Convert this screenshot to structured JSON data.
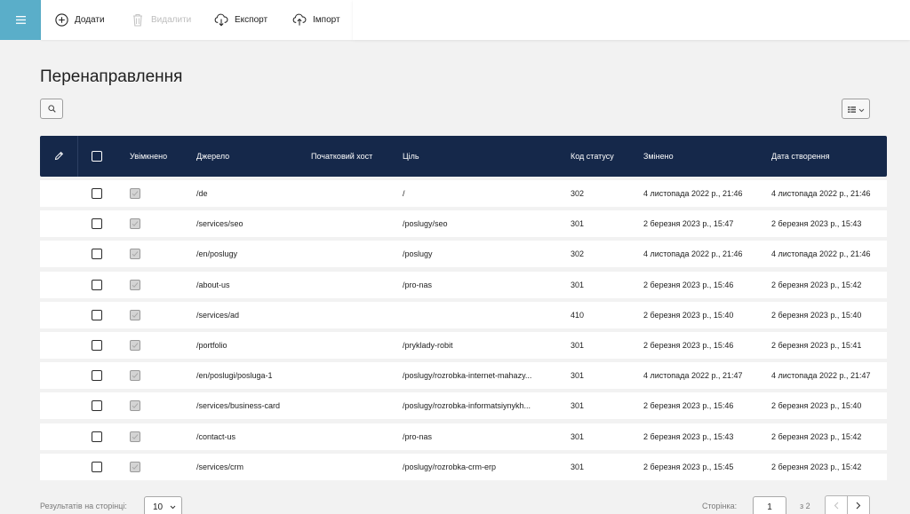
{
  "toolbar": {
    "add_label": "Додати",
    "delete_label": "Видалити",
    "export_label": "Експорт",
    "import_label": "Імпорт"
  },
  "page": {
    "title": "Перенаправлення"
  },
  "colors": {
    "accent": "#5aaec9",
    "header_bg": "#15284a",
    "page_bg": "#f2f2f2"
  },
  "table": {
    "headers": {
      "enabled": "Увімкнено",
      "source": "Джерело",
      "origin_host": "Початковий хост",
      "target": "Ціль",
      "status_code": "Код статусу",
      "modified": "Змінено",
      "created": "Дата створення"
    },
    "rows": [
      {
        "source": "/de",
        "host": "",
        "target": "/",
        "code": "302",
        "modified": "4 листопада 2022 р., 21:46",
        "created": "4 листопада 2022 р., 21:46"
      },
      {
        "source": "/services/seo",
        "host": "",
        "target": "/poslugy/seo",
        "code": "301",
        "modified": "2 березня 2023 р., 15:47",
        "created": "2 березня 2023 р., 15:43"
      },
      {
        "source": "/en/poslugy",
        "host": "",
        "target": "/poslugy",
        "code": "302",
        "modified": "4 листопада 2022 р., 21:46",
        "created": "4 листопада 2022 р., 21:46"
      },
      {
        "source": "/about-us",
        "host": "",
        "target": "/pro-nas",
        "code": "301",
        "modified": "2 березня 2023 р., 15:46",
        "created": "2 березня 2023 р., 15:42"
      },
      {
        "source": "/services/ad",
        "host": "",
        "target": "",
        "code": "410",
        "modified": "2 березня 2023 р., 15:40",
        "created": "2 березня 2023 р., 15:40"
      },
      {
        "source": "/portfolio",
        "host": "",
        "target": "/pryklady-robit",
        "code": "301",
        "modified": "2 березня 2023 р., 15:46",
        "created": "2 березня 2023 р., 15:41"
      },
      {
        "source": "/en/poslugi/posluga-1",
        "host": "",
        "target": "/poslugy/rozrobka-internet-mahazy...",
        "code": "301",
        "modified": "4 листопада 2022 р., 21:47",
        "created": "4 листопада 2022 р., 21:47"
      },
      {
        "source": "/services/business-card",
        "host": "",
        "target": "/poslugy/rozrobka-informatsiynykh...",
        "code": "301",
        "modified": "2 березня 2023 р., 15:46",
        "created": "2 березня 2023 р., 15:40"
      },
      {
        "source": "/contact-us",
        "host": "",
        "target": "/pro-nas",
        "code": "301",
        "modified": "2 березня 2023 р., 15:43",
        "created": "2 березня 2023 р., 15:42"
      },
      {
        "source": "/services/crm",
        "host": "",
        "target": "/poslugy/rozrobka-crm-erp",
        "code": "301",
        "modified": "2 березня 2023 р., 15:45",
        "created": "2 березня 2023 р., 15:42"
      }
    ]
  },
  "footer": {
    "results_per_page_label": "Результатів на сторінці:",
    "per_page_value": "10",
    "page_label": "Сторінка:",
    "current_page": "1",
    "of_pages": "з 2"
  }
}
